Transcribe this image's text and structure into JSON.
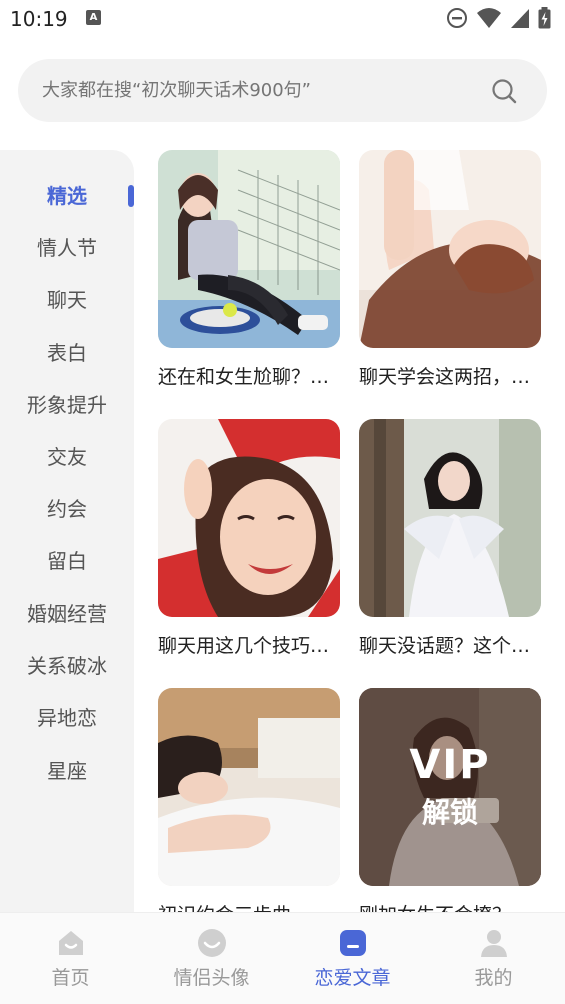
{
  "status_bar": {
    "time": "10:19",
    "a_badge": "A",
    "icons": [
      "dnd-icon",
      "wifi-icon",
      "signal-icon",
      "battery-icon"
    ]
  },
  "search": {
    "placeholder": "大家都在搜“初次聊天话术900句”",
    "icon": "search-icon"
  },
  "sidebar": {
    "accent_color": "#4a67d6",
    "items": [
      {
        "label": "精选",
        "active": true
      },
      {
        "label": "情人节"
      },
      {
        "label": "聊天"
      },
      {
        "label": "表白"
      },
      {
        "label": "形象提升"
      },
      {
        "label": "交友"
      },
      {
        "label": "约会"
      },
      {
        "label": "留白"
      },
      {
        "label": "婚姻经营"
      },
      {
        "label": "关系破冰"
      },
      {
        "label": "异地恋"
      },
      {
        "label": "星座"
      }
    ]
  },
  "articles": [
    {
      "title": "还在和女生尬聊？不如试试这些"
    },
    {
      "title": "聊天学会这两招，轻松撩到女生"
    },
    {
      "title": "聊天用这几个技巧，女生主动找你"
    },
    {
      "title": "聊天没话题？这个方法帮你"
    },
    {
      "title": "初识约会三步曲"
    },
    {
      "title": "刚加女生不会撩？",
      "vip": true,
      "vip_text": "VIP",
      "vip_sub": "解锁"
    }
  ],
  "bottom_nav": {
    "items": [
      {
        "label": "首页",
        "icon": "home-icon"
      },
      {
        "label": "情侣头像",
        "icon": "smile-icon"
      },
      {
        "label": "恋爱文章",
        "icon": "article-icon",
        "active": true
      },
      {
        "label": "我的",
        "icon": "profile-icon"
      }
    ]
  }
}
